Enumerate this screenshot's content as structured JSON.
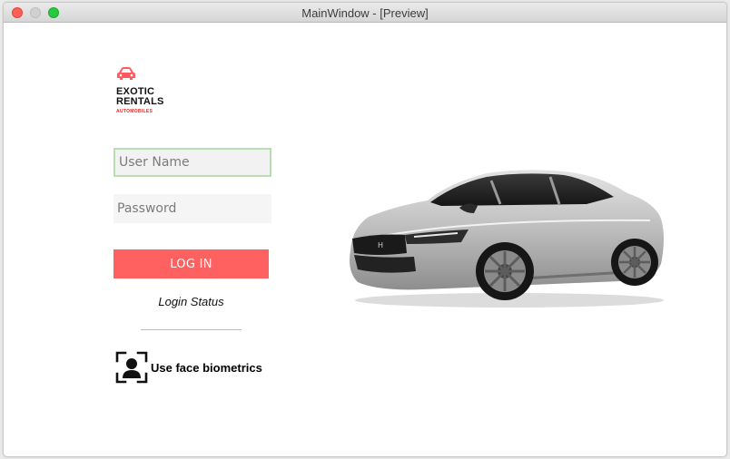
{
  "window": {
    "title": "MainWindow - [Preview]"
  },
  "logo": {
    "line1": "EXOTIC",
    "line2": "RENTALS",
    "subtitle": "AUTOMOBILES",
    "icon": "car-icon",
    "accent_color": "#ff5a5f"
  },
  "form": {
    "username_placeholder": "User Name",
    "username_value": "",
    "password_placeholder": "Password",
    "password_value": "",
    "login_label": "LOG IN",
    "login_color": "#ff6060",
    "status_text": "Login Status"
  },
  "biometrics": {
    "label": "Use face biometrics",
    "icon": "face-id-icon"
  },
  "hero": {
    "image": "silver-sedan-image"
  }
}
